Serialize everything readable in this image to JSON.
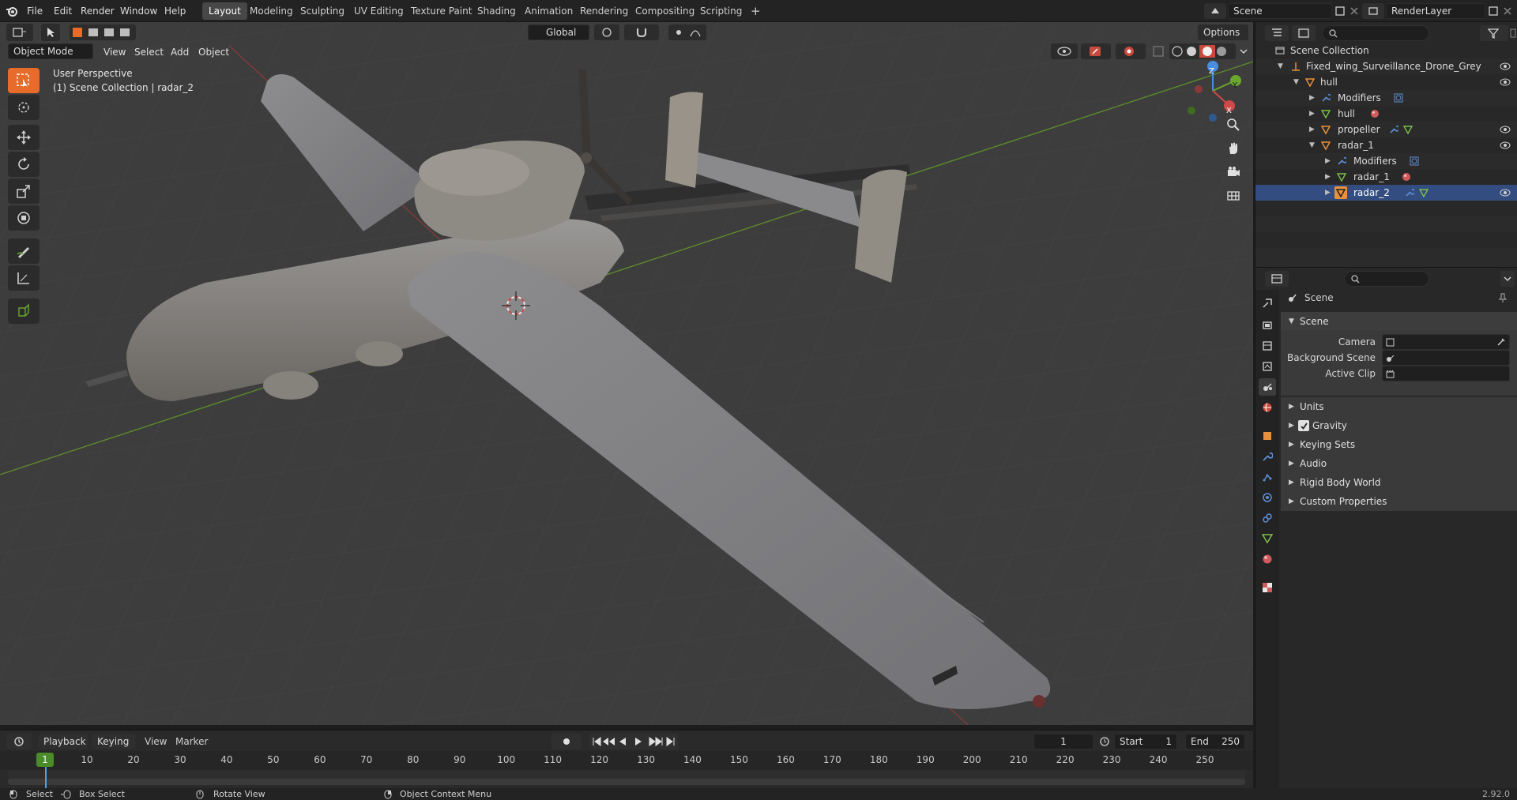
{
  "topbar": {
    "menus": [
      "File",
      "Edit",
      "Render",
      "Window",
      "Help"
    ],
    "workspaces": [
      "Layout",
      "Modeling",
      "Sculpting",
      "UV Editing",
      "Texture Paint",
      "Shading",
      "Animation",
      "Rendering",
      "Compositing",
      "Scripting"
    ],
    "active_workspace": "Layout",
    "add_tab": "+",
    "scene_name": "Scene",
    "view_layer": "RenderLayer"
  },
  "viewport": {
    "mode": "Object Mode",
    "menus": [
      "View",
      "Select",
      "Add",
      "Object"
    ],
    "orientation": "Global",
    "options": "Options",
    "perspective_label": "User Perspective",
    "collection_label": "(1) Scene Collection | radar_2",
    "gizmo": {
      "z": "Z",
      "y": "Y",
      "x": "X"
    }
  },
  "outliner": {
    "root": "Scene Collection",
    "rows": [
      {
        "label": "Fixed_wing_Surveillance_Drone_Grey",
        "indent": 1
      },
      {
        "label": "hull",
        "indent": 2
      },
      {
        "label": "Modifiers",
        "indent": 3
      },
      {
        "label": "hull",
        "indent": 3
      },
      {
        "label": "propeller",
        "indent": 3
      },
      {
        "label": "radar_1",
        "indent": 3
      },
      {
        "label": "Modifiers",
        "indent": 4
      },
      {
        "label": "radar_1",
        "indent": 4
      },
      {
        "label": "radar_2",
        "indent": 4
      }
    ]
  },
  "properties": {
    "context": "Scene",
    "panel": "Scene",
    "fields": [
      {
        "label": "Camera"
      },
      {
        "label": "Background Scene"
      },
      {
        "label": "Active Clip"
      }
    ],
    "subpanels": [
      "Units",
      "Gravity",
      "Keying Sets",
      "Audio",
      "Rigid Body World",
      "Custom Properties"
    ],
    "gravity_checked": true
  },
  "timeline": {
    "menus": [
      "Playback",
      "Keying",
      "View",
      "Marker"
    ],
    "current_frame": "1",
    "start_label": "Start",
    "start": "1",
    "end_label": "End",
    "end": "250",
    "ticks": [
      "1",
      "10",
      "20",
      "30",
      "40",
      "50",
      "60",
      "70",
      "80",
      "90",
      "100",
      "110",
      "120",
      "130",
      "140",
      "150",
      "160",
      "170",
      "180",
      "190",
      "200",
      "210",
      "220",
      "230",
      "240",
      "250"
    ]
  },
  "statusbar": {
    "select": "Select",
    "box_select": "Box Select",
    "rotate_view": "Rotate View",
    "context_menu": "Object Context Menu",
    "version": "2.92.0"
  },
  "colors": {
    "accent": "#e76b2b",
    "selection": "#334d80",
    "x_axis": "#d04848",
    "y_axis": "#6aa72e",
    "z_axis": "#4a8ddc"
  }
}
